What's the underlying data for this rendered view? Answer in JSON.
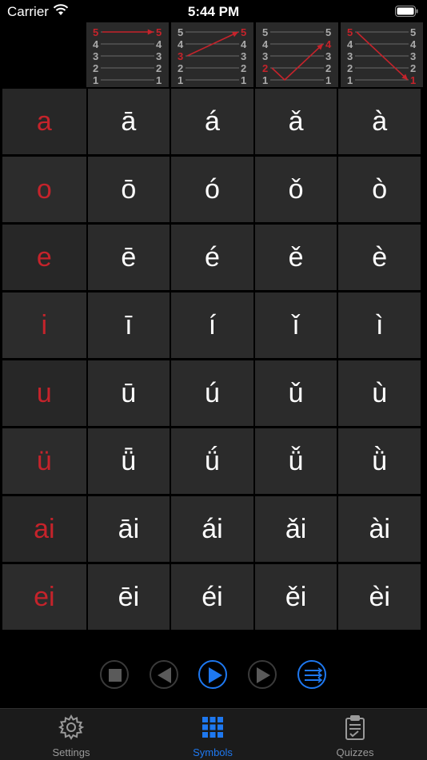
{
  "status_bar": {
    "carrier": "Carrier",
    "time": "5:44 PM"
  },
  "tone_diagrams": [
    {
      "left_levels": [
        "5",
        "4",
        "3",
        "2",
        "1"
      ],
      "right_levels": [
        "5",
        "4",
        "3",
        "2",
        "1"
      ],
      "start": 5,
      "end": 5,
      "mid": null,
      "highlight": [
        "5"
      ]
    },
    {
      "left_levels": [
        "5",
        "4",
        "3",
        "2",
        "1"
      ],
      "right_levels": [
        "5",
        "4",
        "3",
        "2",
        "1"
      ],
      "start": 3,
      "end": 5,
      "mid": null,
      "highlight": [
        "3",
        "5"
      ]
    },
    {
      "left_levels": [
        "5",
        "4",
        "3",
        "2",
        "1"
      ],
      "right_levels": [
        "5",
        "4",
        "3",
        "2",
        "1"
      ],
      "start": 2,
      "end": 4,
      "mid": 1,
      "highlight": [
        "2",
        "4"
      ]
    },
    {
      "left_levels": [
        "5",
        "4",
        "3",
        "2",
        "1"
      ],
      "right_levels": [
        "5",
        "4",
        "3",
        "2",
        "1"
      ],
      "start": 5,
      "end": 1,
      "mid": null,
      "highlight": [
        "5",
        "1"
      ]
    }
  ],
  "rows": [
    {
      "base": "a",
      "tones": [
        "ā",
        "á",
        "ǎ",
        "à"
      ]
    },
    {
      "base": "o",
      "tones": [
        "ō",
        "ó",
        "ǒ",
        "ò"
      ]
    },
    {
      "base": "e",
      "tones": [
        "ē",
        "é",
        "ě",
        "è"
      ]
    },
    {
      "base": "i",
      "tones": [
        "ī",
        "í",
        "ǐ",
        "ì"
      ]
    },
    {
      "base": "u",
      "tones": [
        "ū",
        "ú",
        "ǔ",
        "ù"
      ]
    },
    {
      "base": "ü",
      "tones": [
        "ǖ",
        "ǘ",
        "ǚ",
        "ǜ"
      ]
    },
    {
      "base": "ai",
      "tones": [
        "āi",
        "ái",
        "ǎi",
        "ài"
      ]
    },
    {
      "base": "ei",
      "tones": [
        "ēi",
        "éi",
        "ěi",
        "èi"
      ]
    }
  ],
  "colors": {
    "accent": "#1e78f0",
    "base_text": "#c5232b",
    "tone_arrow": "#c5232b"
  },
  "tabs": [
    {
      "label": "Settings",
      "icon": "gear-icon",
      "active": false
    },
    {
      "label": "Symbols",
      "icon": "grid-icon",
      "active": true
    },
    {
      "label": "Quizzes",
      "icon": "clipboard-icon",
      "active": false
    }
  ]
}
